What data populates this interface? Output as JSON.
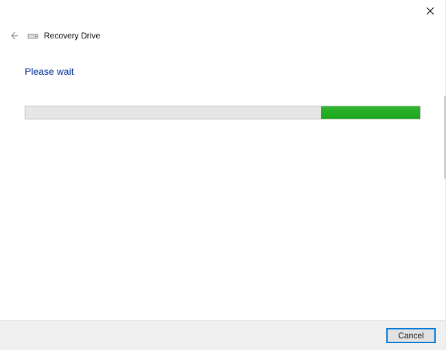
{
  "window": {
    "title": "Recovery Drive"
  },
  "content": {
    "heading": "Please wait"
  },
  "progress": {
    "fill_left_percent": 75,
    "fill_width_percent": 25,
    "color": "#1aa61a"
  },
  "footer": {
    "cancel_label": "Cancel"
  }
}
